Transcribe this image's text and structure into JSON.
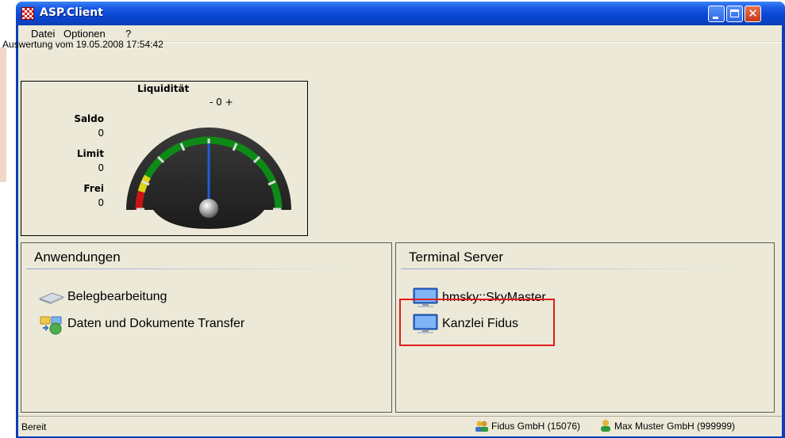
{
  "window": {
    "title": "ASP.Client"
  },
  "menu": {
    "items": [
      {
        "label": "Datei"
      },
      {
        "label": "Optionen"
      },
      {
        "label": "?"
      }
    ]
  },
  "header": {
    "auswertung": "Auswertung vom 19.05.2008 17:54:42"
  },
  "gauge": {
    "title": "Liquidität",
    "scale_label": "- 0 +",
    "saldo_label": "Saldo",
    "saldo_value": "0",
    "limit_label": "Limit",
    "limit_value": "0",
    "frei_label": "Frei",
    "frei_value": "0",
    "needle_value": 0,
    "colors": {
      "face": "#2b2b2b",
      "band_green": "#0e8a16",
      "band_yellow": "#e0d21a",
      "band_red": "#c81414",
      "needle": "#1f5fd6"
    }
  },
  "anwendungen": {
    "title": "Anwendungen",
    "items": [
      {
        "label": "Belegbearbeitung",
        "icon": "scanner-icon"
      },
      {
        "label": "Daten und Dokumente Transfer",
        "icon": "transfer-icon"
      }
    ]
  },
  "terminal": {
    "title": "Terminal Server",
    "items": [
      {
        "label": "hmsky::SkyMaster",
        "icon": "monitor-icon"
      },
      {
        "label": "Kanzlei Fidus",
        "icon": "monitor-icon"
      }
    ]
  },
  "status": {
    "left": "Bereit",
    "company": "Fidus GmbH (15076)",
    "client": "Max Muster GmbH (999999)"
  },
  "colors": {
    "highlight_box": "#e31b1b",
    "titlebar": "#0a47d6"
  }
}
